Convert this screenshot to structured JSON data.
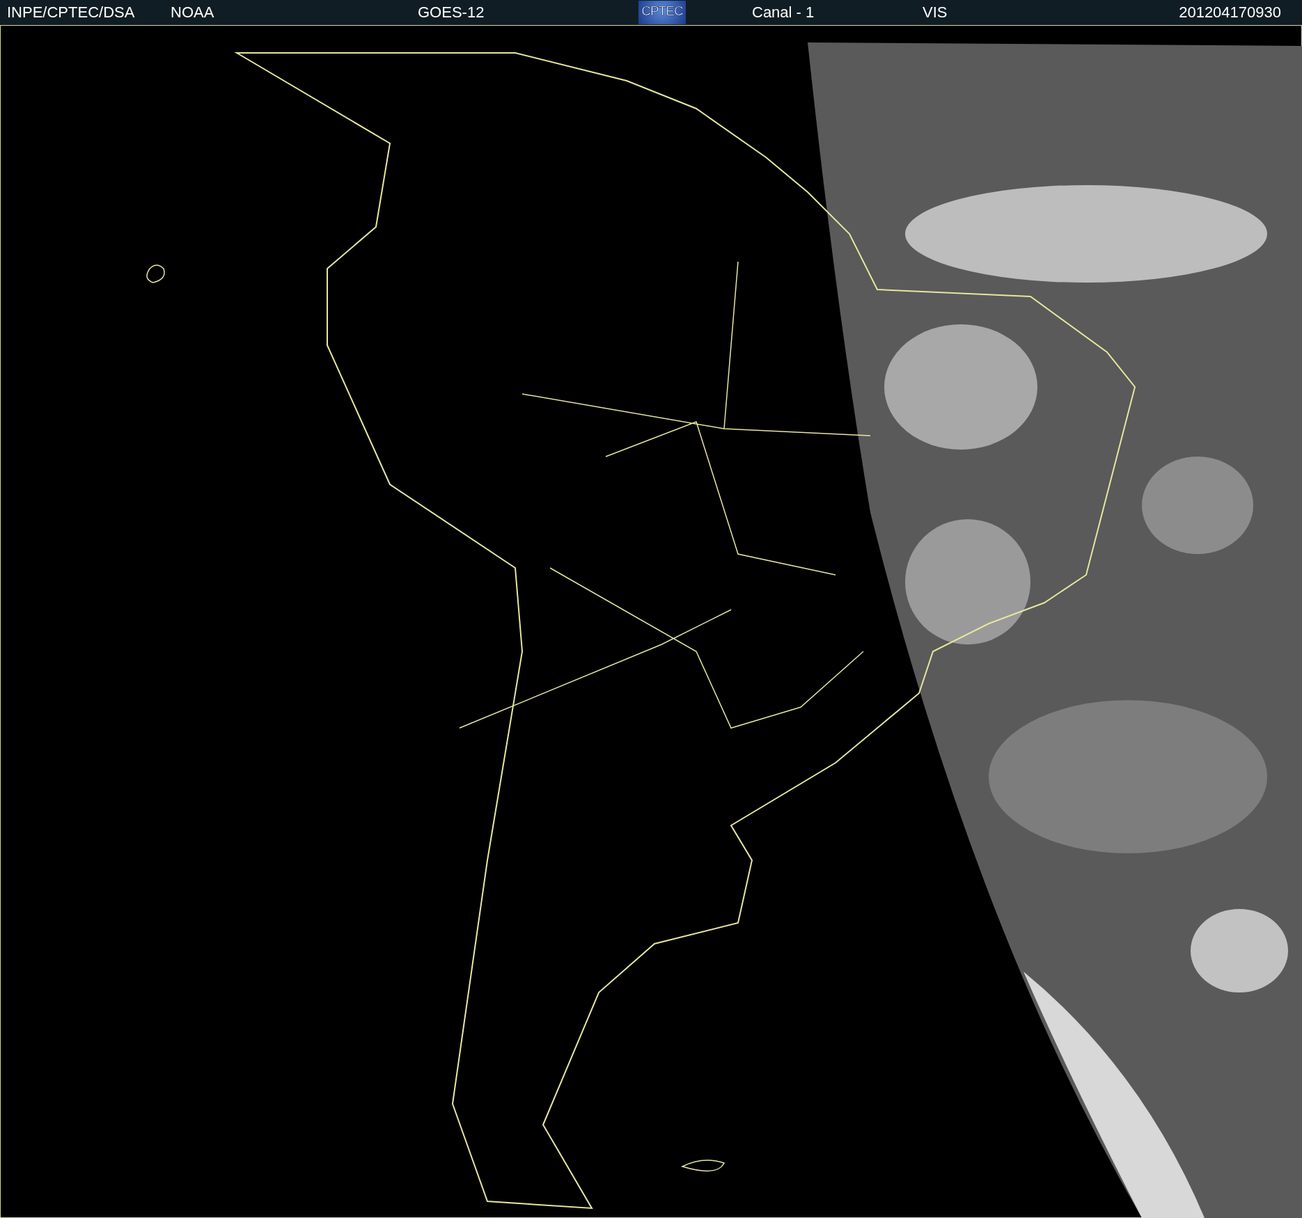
{
  "header": {
    "items": [
      {
        "kind": "text",
        "text": "INPE/CPTEC/DSA"
      },
      {
        "kind": "text",
        "text": "NOAA"
      },
      {
        "kind": "text",
        "text": "GOES-12"
      },
      {
        "kind": "logo",
        "text": "CPTEC"
      },
      {
        "kind": "text",
        "text": "Canal - 1"
      },
      {
        "kind": "text",
        "text": "VIS"
      },
      {
        "kind": "text",
        "text": "201204170930"
      }
    ]
  }
}
